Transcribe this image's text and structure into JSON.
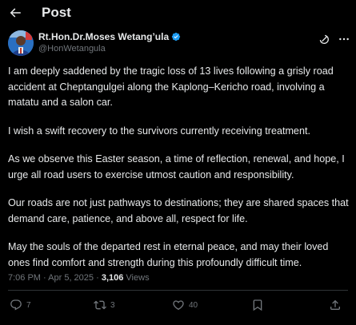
{
  "header": {
    "title": "Post",
    "back_icon": "arrow-left-icon"
  },
  "author": {
    "display_name": "Rt.Hon.Dr.Moses Wetang’ula",
    "handle": "@HonWetangula",
    "verified_color": "#1d9bf0"
  },
  "post": {
    "paragraphs": [
      "I am deeply saddened by the tragic loss of 13 lives following a grisly road accident at Cheptangulgei along the Kaplong–Kericho road, involving a matatu and a salon car.",
      "I wish a swift recovery to the survivors currently receiving treatment.",
      "As we observe this Easter season, a time of reflection, renewal, and hope, I urge all road users to exercise utmost caution and responsibility.",
      "Our roads are not just pathways to destinations; they are shared spaces that demand care, patience, and above all, respect for life.",
      "May the souls of the departed rest in eternal peace, and may their loved ones find comfort and strength during this profoundly difficult time."
    ]
  },
  "meta": {
    "time": "7:06 PM",
    "separator": "·",
    "date": "Apr 5, 2025",
    "views_count": "3,106",
    "views_label": "Views"
  },
  "actions": {
    "replies": "7",
    "reposts": "3",
    "likes": "40"
  },
  "colors": {
    "background": "#000000",
    "text": "#e7e9ea",
    "muted": "#71767b",
    "divider": "#2f3336"
  }
}
